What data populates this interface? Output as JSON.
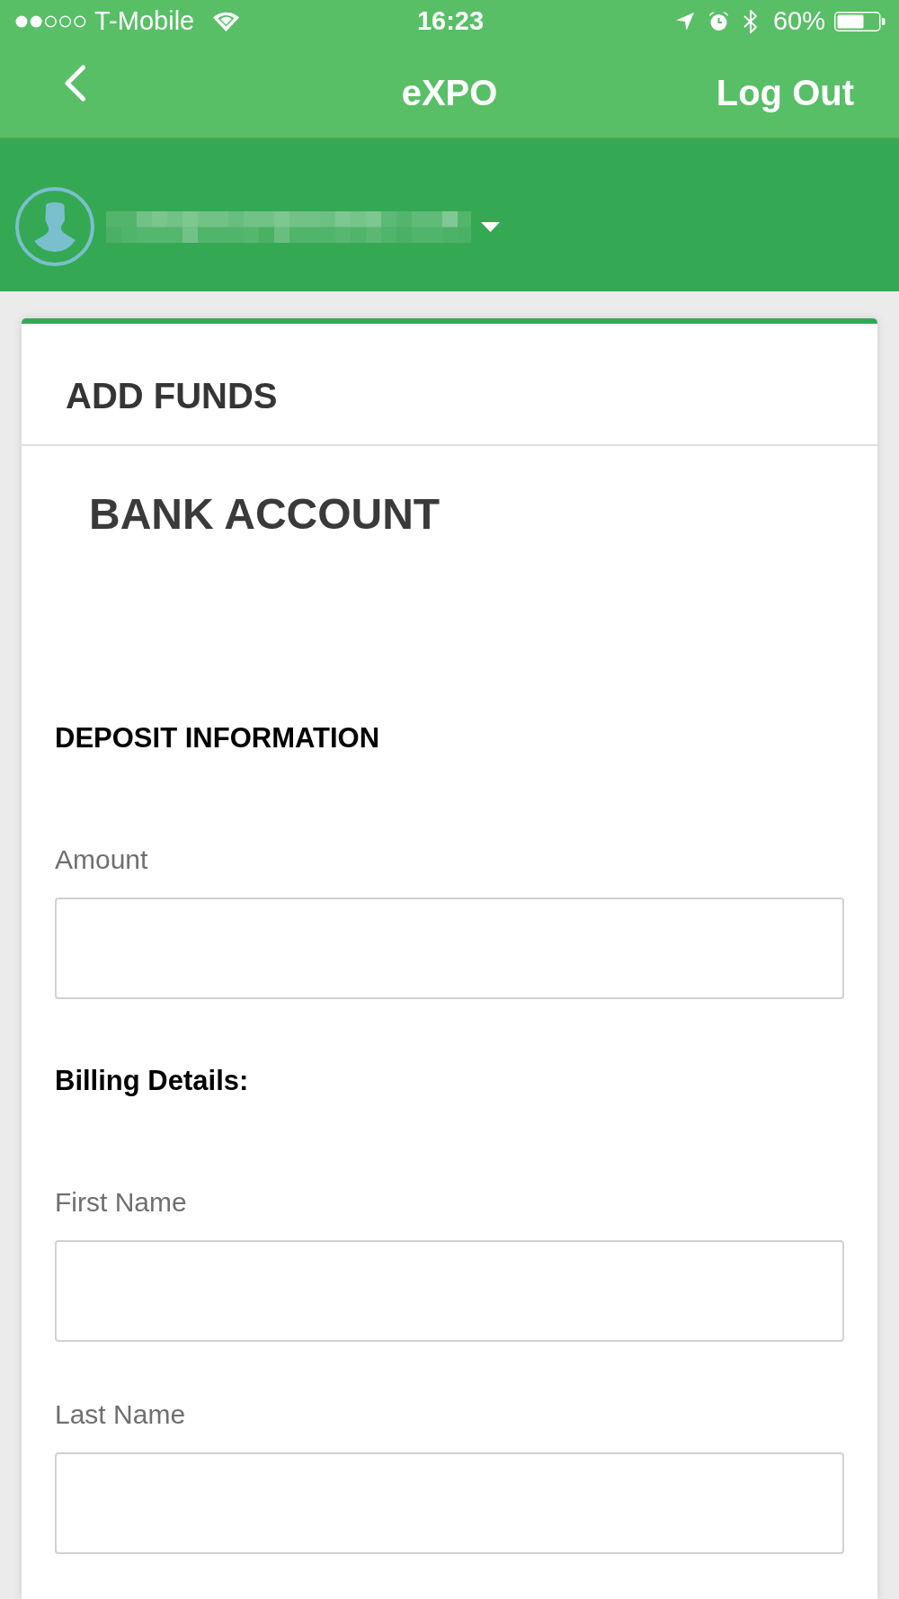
{
  "status_bar": {
    "carrier": "T-Mobile",
    "time": "16:23",
    "battery": "60%"
  },
  "nav_bar": {
    "title": "eXPO",
    "action": "Log Out"
  },
  "card": {
    "title": "ADD FUNDS",
    "subtitle": "BANK ACCOUNT",
    "sections": [
      {
        "heading": "DEPOSIT INFORMATION",
        "fields": [
          {
            "label": "Amount"
          }
        ]
      },
      {
        "heading": "Billing Details:",
        "fields": [
          {
            "label": "First Name"
          },
          {
            "label": "Last Name"
          }
        ]
      }
    ]
  }
}
